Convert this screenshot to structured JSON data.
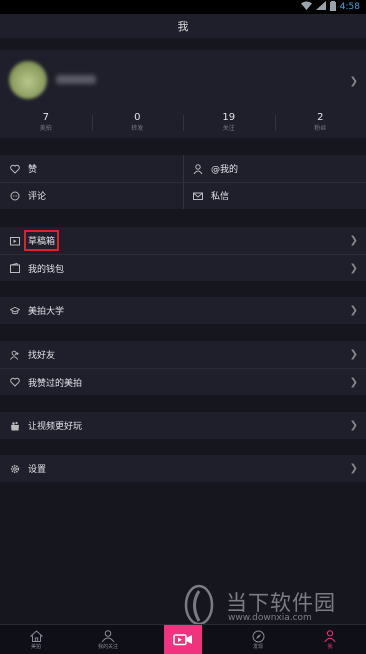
{
  "statusbar": {
    "time": "4:58"
  },
  "header": {
    "title": "我"
  },
  "profile": {
    "stats": [
      {
        "value": "7",
        "label": "美拍"
      },
      {
        "value": "0",
        "label": "转发"
      },
      {
        "value": "19",
        "label": "关注"
      },
      {
        "value": "2",
        "label": "粉丝"
      }
    ]
  },
  "social": {
    "like": "赞",
    "at_me": "@我的",
    "comment": "评论",
    "message": "私信"
  },
  "menu": {
    "drafts": "草稿箱",
    "wallet": "我的钱包",
    "university": "美拍大学",
    "find_friends": "找好友",
    "liked": "我赞过的美拍",
    "better_video": "让视频更好玩",
    "settings": "设置"
  },
  "tabbar": {
    "home": "美拍",
    "following": "我的关注",
    "discover": "发现",
    "me": "我"
  },
  "watermark": {
    "brand": "当下软件园",
    "url": "www.downxia.com"
  },
  "colors": {
    "accent": "#f0327f",
    "highlight": "#e0202a",
    "bg": "#16161f",
    "panel": "#1f1f2b"
  }
}
